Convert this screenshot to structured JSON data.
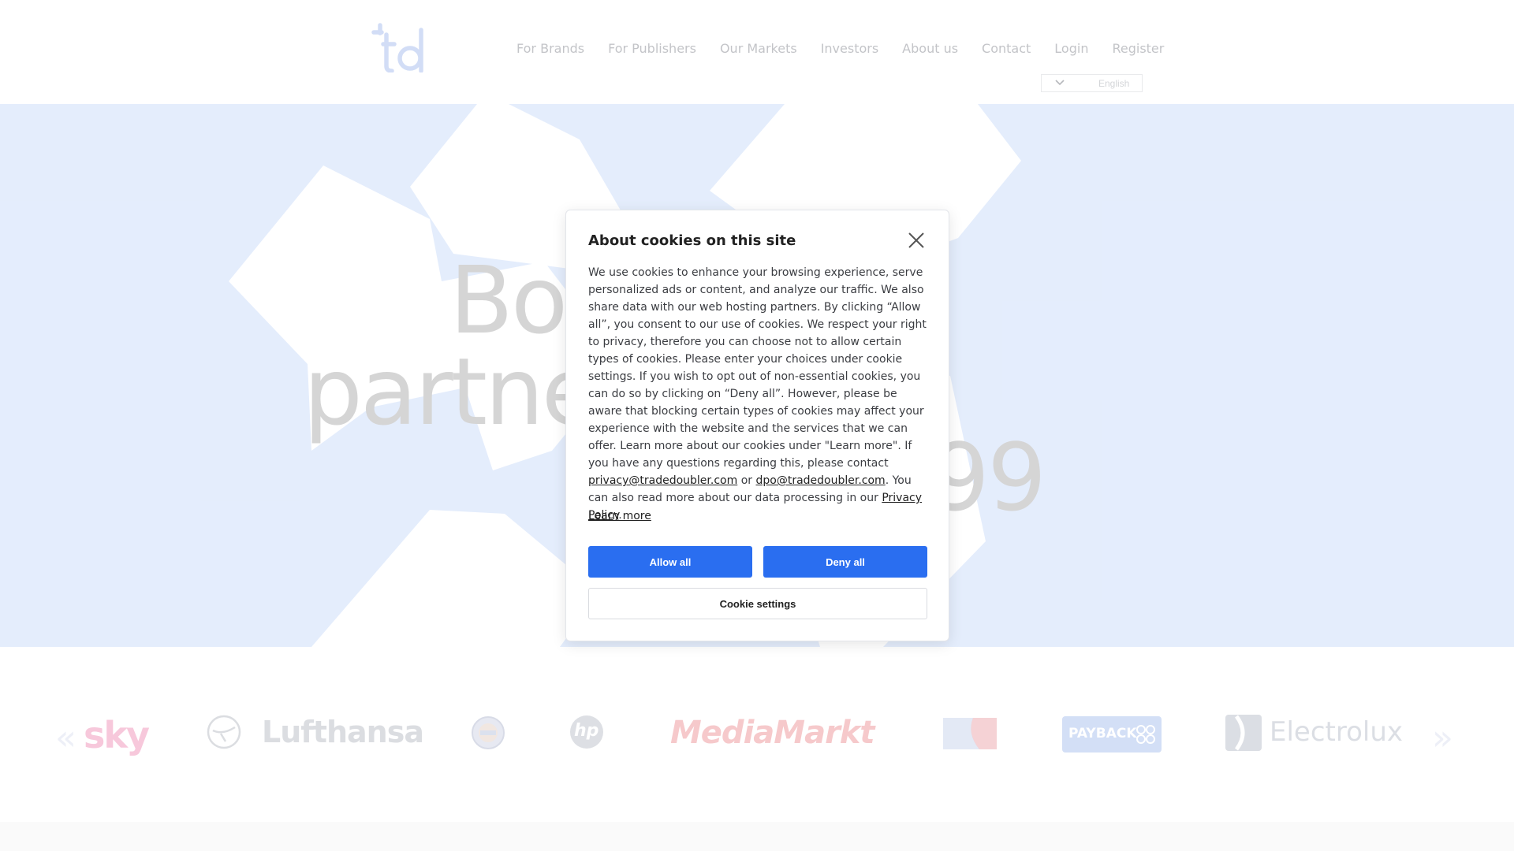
{
  "header": {
    "nav": [
      {
        "label": "For Brands"
      },
      {
        "label": "For Publishers"
      },
      {
        "label": "Our Markets"
      },
      {
        "label": "Investors"
      },
      {
        "label": "About us"
      },
      {
        "label": "Contact"
      },
      {
        "label": "Login"
      },
      {
        "label": "Register"
      }
    ],
    "language": "English",
    "logo_text": "td"
  },
  "hero": {
    "line1": "Bo",
    "line2": "partne",
    "line3": "99"
  },
  "logos": {
    "brands": [
      "sky",
      "Lufthansa",
      "hp",
      "MediaMarkt",
      "PAYBACK",
      "Electrolux"
    ],
    "prev_arrow": "«",
    "next_arrow": "»"
  },
  "cookie_modal": {
    "title": "About cookies on this site",
    "body_main": "We use cookies to enhance your browsing experience, serve personalized ads or content, and analyze our traffic. We also share data with our web hosting partners. By clicking “Allow all”, you consent to our use of cookies. We respect your right to privacy, therefore you can choose not to allow certain types of cookies. Please enter your choices under cookie settings. If you wish to opt out of non-essential cookies, you can do so by clicking on “Deny all”. However, please be aware that blocking certain types of cookies may affect your experience with the website and the services that we can offer. Learn more about our cookies under \"Learn more\". If you have any questions regarding this, please contact ",
    "privacy_email": "privacy@tradedoubler.com",
    "or_text": " or ",
    "dpo_email": "dpo@tradedoubler.com",
    "body_tail": ". You can also read more about our data processing in our ",
    "privacy_policy": "Privacy Policy",
    "period": ".",
    "learn_more": "Learn more",
    "allow_all": "Allow all",
    "deny_all": "Deny all",
    "cookie_settings": "Cookie settings"
  },
  "colors": {
    "accent": "#2a6ef0",
    "hero_bg": "#d4e2fb",
    "logo": "#b7c9f0"
  }
}
